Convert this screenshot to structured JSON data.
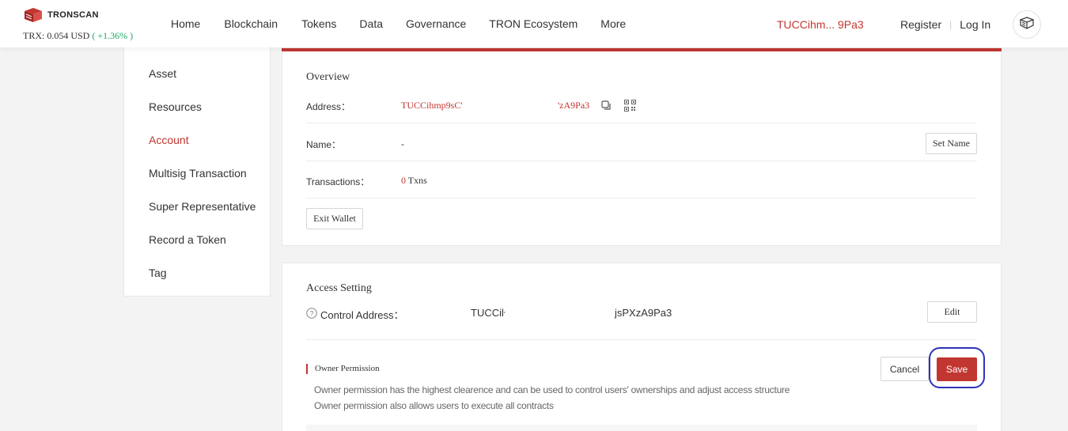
{
  "header": {
    "logo_text": "TRONSCAN",
    "price_label": "TRX: 0.054 USD",
    "price_change": "( +1.36% )",
    "nav": [
      "Home",
      "Blockchain",
      "Tokens",
      "Data",
      "Governance",
      "TRON Ecosystem",
      "More"
    ],
    "account_address": "TUCCihm... 9Pa3",
    "register": "Register",
    "divider": "|",
    "login": "Log In"
  },
  "sidebar": {
    "items": [
      {
        "label": "Asset"
      },
      {
        "label": "Resources"
      },
      {
        "label": "Account",
        "active": true
      },
      {
        "label": "Multisig Transaction"
      },
      {
        "label": "Super Representative"
      },
      {
        "label": "Record a Token"
      },
      {
        "label": "Tag"
      }
    ]
  },
  "overview": {
    "title": "Overview",
    "address_label": "Address：",
    "address_start": "TUCCihmp9sC'",
    "address_end": "'zA9Pa3",
    "name_label": "Name：",
    "name_value": "-",
    "set_name": "Set Name",
    "tx_label": "Transactions：",
    "tx_count": "0",
    "tx_unit": "Txns",
    "exit_wallet": "Exit Wallet"
  },
  "access": {
    "title": "Access Setting",
    "control_label": "Control Address：",
    "control_start": "TUCCiŀ",
    "control_end": "jsPXzA9Pa3",
    "edit": "Edit",
    "owner_title": "Owner Permission",
    "owner_desc_1": "Owner permission has the highest clearence and can be used to control users' ownerships and adjust access structure",
    "owner_desc_2": "Owner permission also allows users to execute all contracts",
    "cancel": "Cancel",
    "save": "Save"
  },
  "colors": {
    "accent": "#c23631",
    "positive": "#1ea868",
    "highlight": "#2f32b8"
  }
}
